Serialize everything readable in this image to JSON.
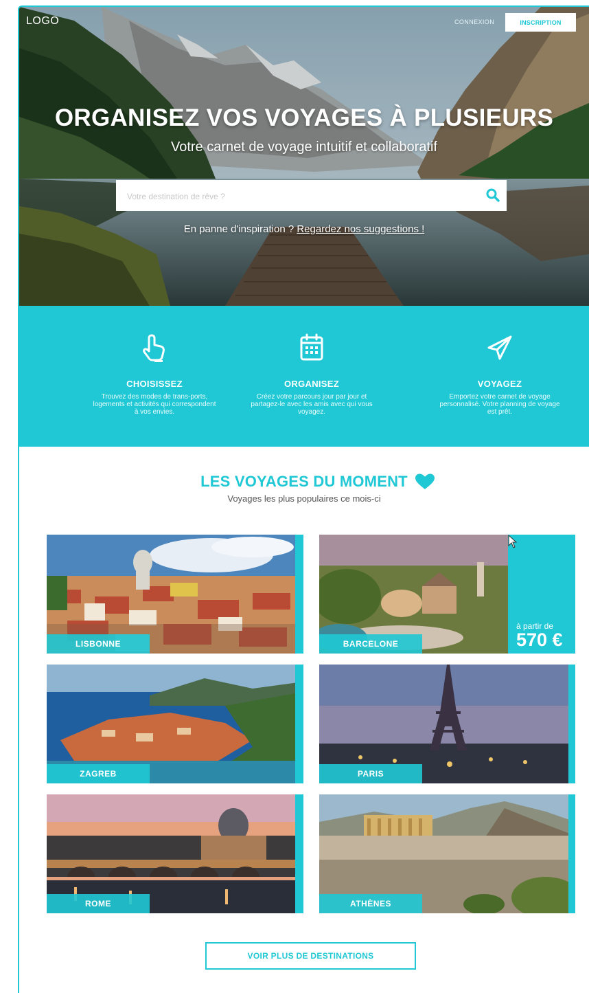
{
  "header": {
    "logo": "LOGO",
    "login_label": "CONNEXION",
    "signup_label": "INSCRIPTION"
  },
  "hero": {
    "title": "ORGANISEZ VOS VOYAGES À PLUSIEURS",
    "subtitle": "Votre carnet de voyage intuitif et collaboratif",
    "search_placeholder": "Votre destination de rêve ?",
    "inspiration_text": "En panne d'inspiration ? ",
    "inspiration_link": "Regardez nos suggestions !"
  },
  "features": [
    {
      "icon": "pointing-hand-icon",
      "title": "CHOISISSEZ",
      "description": "Trouvez des modes de trans-ports, logements et activités qui correspondent à vos envies."
    },
    {
      "icon": "calendar-icon",
      "title": "ORGANISEZ",
      "description": "Créez votre parcours jour par jour et partagez-le avec les amis avec qui vous voyagez."
    },
    {
      "icon": "paper-plane-icon",
      "title": "VOYAGEZ",
      "description": "Emportez votre carnet de voyage personnalisé. Votre planning de voyage est prêt."
    }
  ],
  "moment": {
    "title": "LES VOYAGES DU MOMENT",
    "subtitle": "Voyages les plus populaires ce mois-ci",
    "heart_icon": "heart-icon"
  },
  "destinations": [
    {
      "name": "LISBONNE"
    },
    {
      "name": "BARCELONE",
      "price_prefix": "à partir de",
      "price": "570 €"
    },
    {
      "name": "ZAGREB"
    },
    {
      "name": "PARIS"
    },
    {
      "name": "ROME"
    },
    {
      "name": "ATHÈNES"
    }
  ],
  "more_button": "VOIR PLUS DE DESTINATIONS",
  "colors": {
    "accent": "#1fc8d4",
    "white": "#ffffff",
    "muted_text": "#555555"
  }
}
